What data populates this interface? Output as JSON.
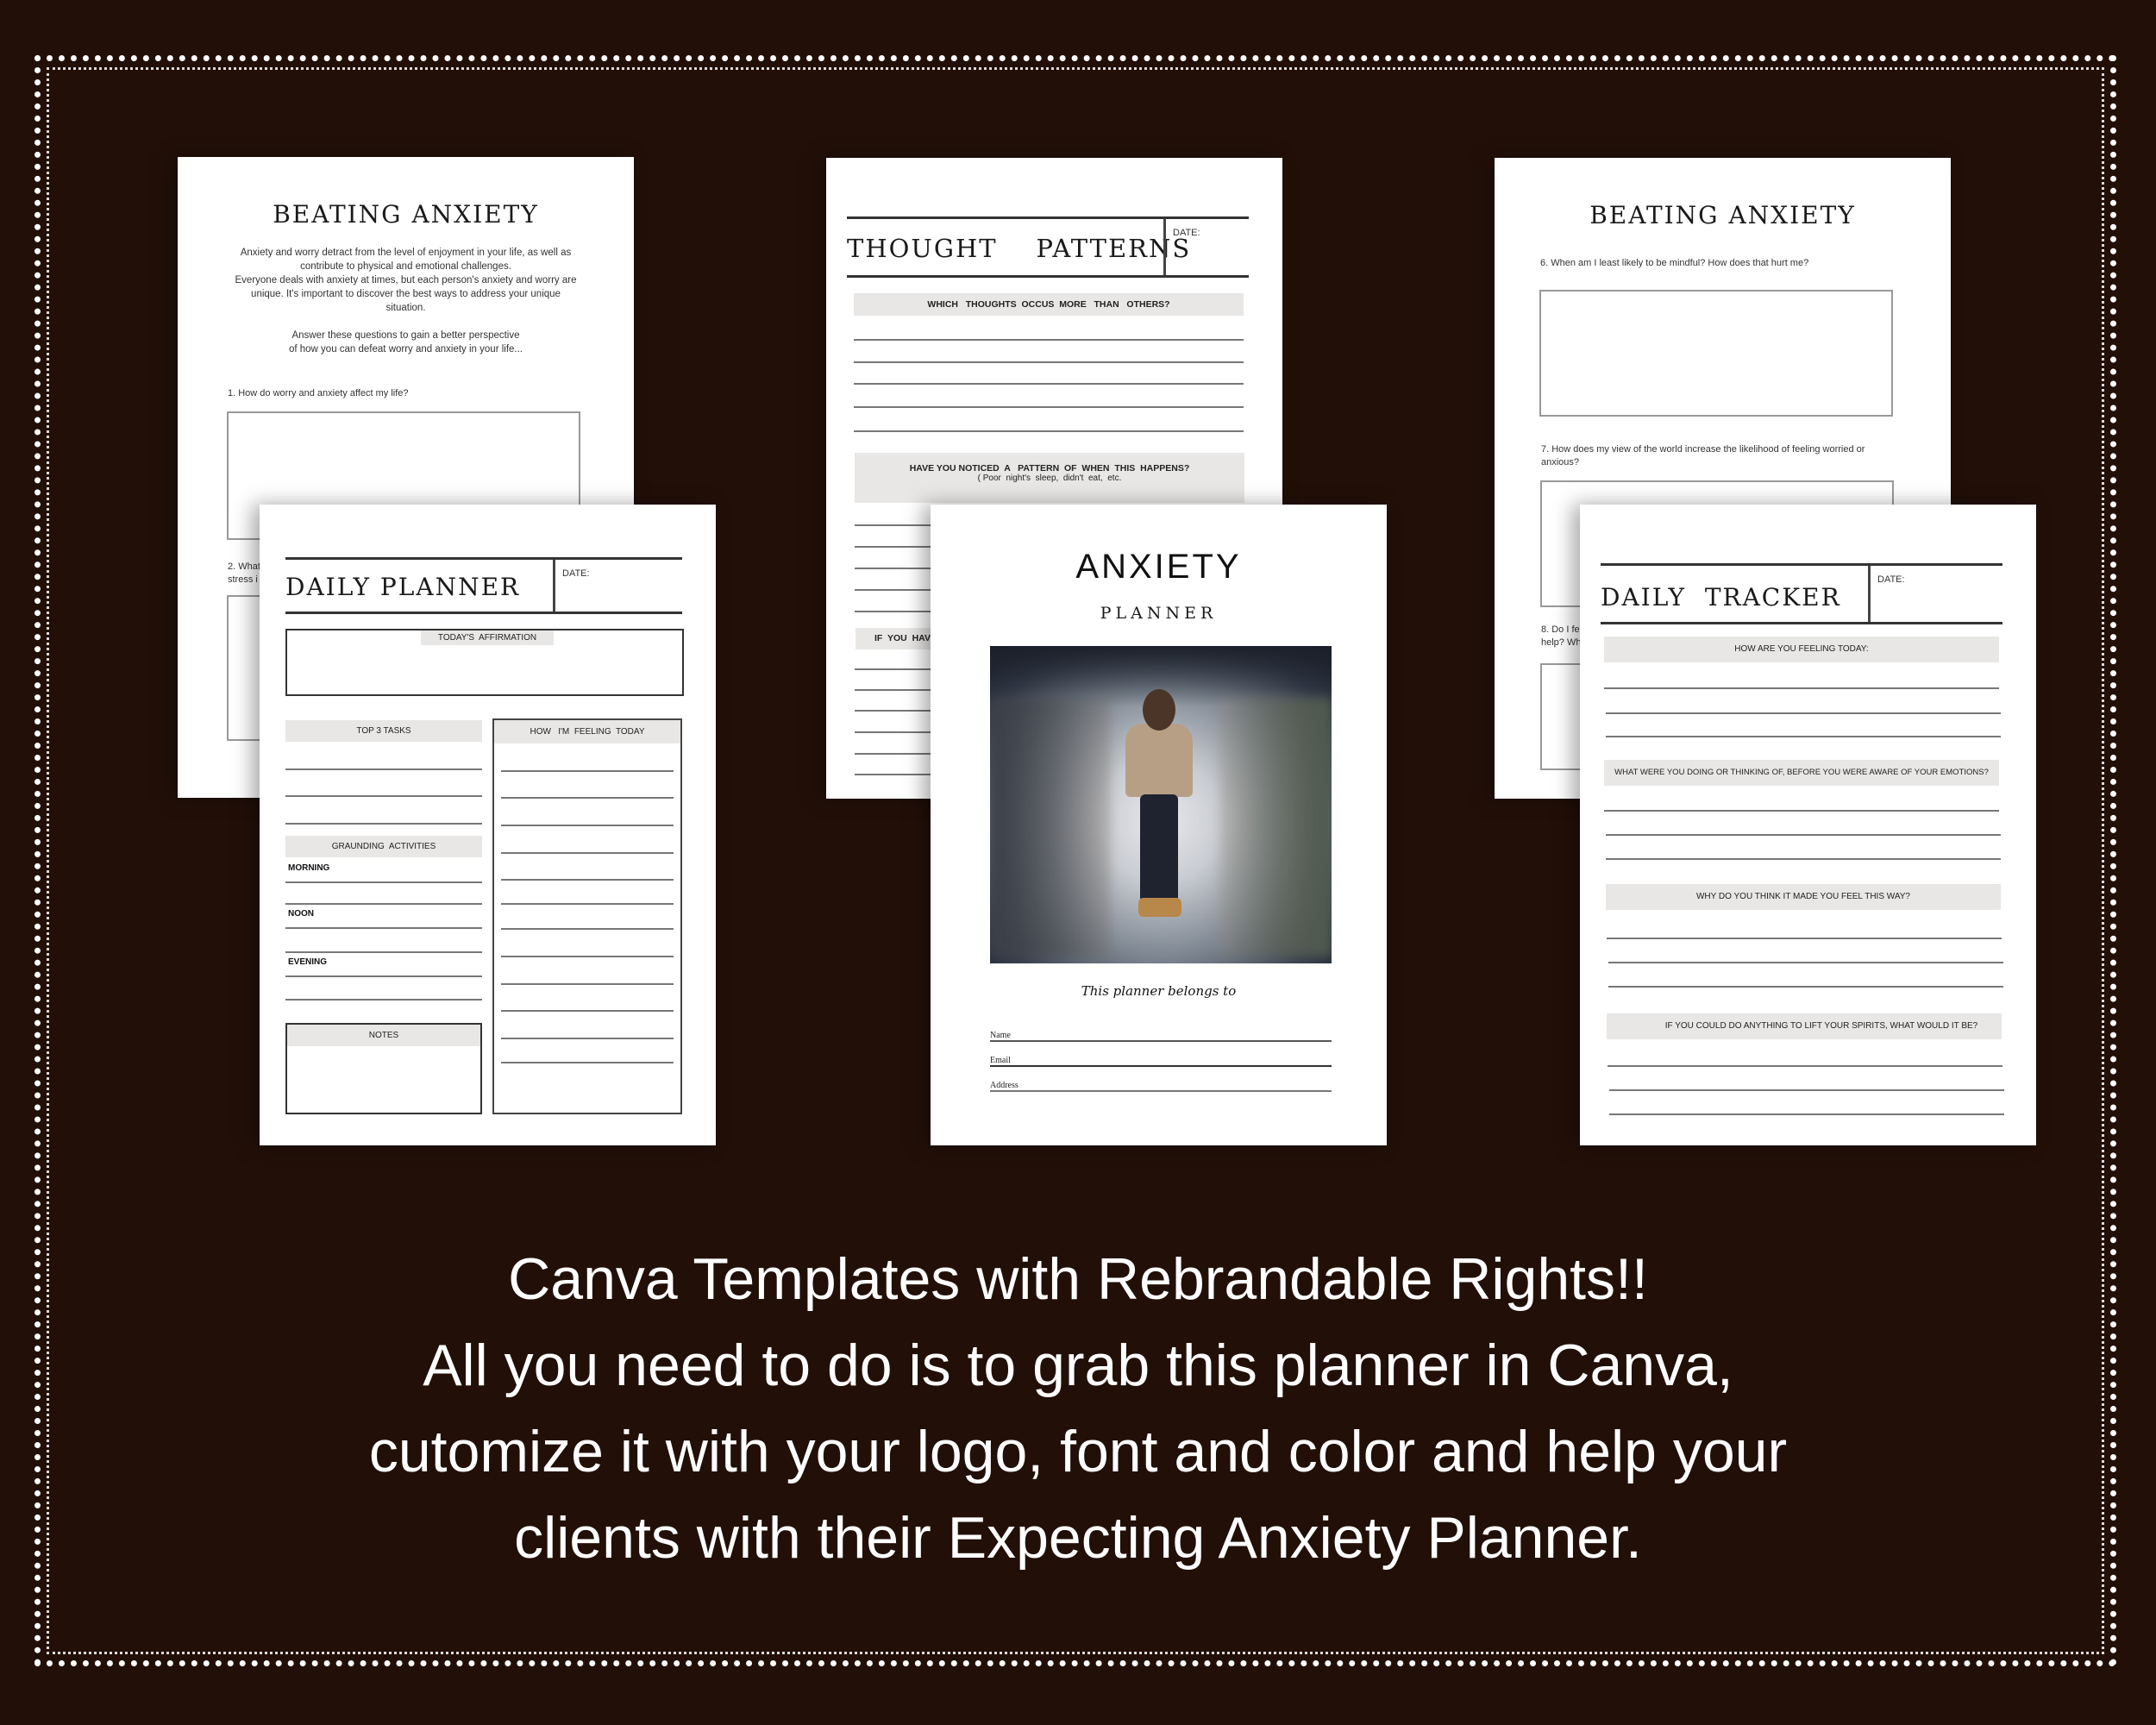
{
  "colors": {
    "background": "#221008",
    "paper": "#ffffff",
    "band": "#e8e7e5",
    "ink": "#1a1a1a"
  },
  "cards": {
    "beating_left": {
      "title": "BEATING ANXIETY",
      "intro": [
        "Anxiety and worry detract from the level of enjoyment in your life, as well as",
        "contribute to physical and emotional challenges.",
        "Everyone deals with anxiety at times, but each person's anxiety and worry are",
        "unique. It's important to discover the best ways to address your unique",
        "situation."
      ],
      "prompt": [
        "Answer these questions to gain a better perspective",
        "of how you can defeat worry and anxiety in your life..."
      ],
      "q1": "1. How do worry and anxiety affect my life?",
      "q2": [
        "2. What",
        "stress i"
      ]
    },
    "daily_planner": {
      "title": "DAILY PLANNER",
      "date_label": "DATE:",
      "affirmation": "TODAY'S  AFFIRMATION",
      "tasks": "TOP 3 TASKS",
      "feeling": "HOW   I'M  FEELING  TODAY",
      "grounding": "GRAUNDING  ACTIVITIES",
      "morning": "MORNING",
      "noon": "NOON",
      "evening": "EVENING",
      "notes": "NOTES"
    },
    "thought_patterns": {
      "title": "THOUGHT    PATTERNS",
      "date_label": "DATE:",
      "q1": "WHICH   THOUGHTS  OCCUS  MORE   THAN   OTHERS?",
      "q2": "HAVE YOU NOTICED  A   PATTERN  OF  WHEN  THIS  HAPPENS?",
      "q2_sub": "( Poor  night's  sleep,  didn't  eat,  etc.",
      "q3": "IF  YOU  HAV"
    },
    "cover": {
      "title": "ANXIETY",
      "subtitle": "PLANNER",
      "belongs": "This planner belongs to",
      "fields": [
        "Name",
        "Email",
        "Address"
      ]
    },
    "beating_right": {
      "title": "BEATING ANXIETY",
      "q6": "6. When am I least likely to be mindful? How does that hurt me?",
      "q7": [
        "7. How does my view of the world increase the likelihood of feeling worried or",
        "anxious?"
      ],
      "q8": [
        "8. Do I fe",
        "help? Wh"
      ]
    },
    "daily_tracker": {
      "title": "DAILY  TRACKER",
      "date_label": "DATE:",
      "q1": "HOW ARE YOU FEELING TODAY:",
      "q2": "WHAT WERE YOU DOING OR THINKING OF, BEFORE YOU WERE AWARE OF YOUR EMOTIONS?",
      "q3": "WHY DO YOU THINK IT MADE YOU FEEL THIS WAY?",
      "q4": "IF YOU COULD DO ANYTHING TO LIFT YOUR SPIRITS, WHAT WOULD IT BE?"
    }
  },
  "tagline": [
    "Canva Templates with Rebrandable Rights!!",
    "All you need to do is to grab this planner in Canva,",
    "cutomize it with your logo, font and color and help your",
    "clients with their Expecting Anxiety Planner."
  ]
}
